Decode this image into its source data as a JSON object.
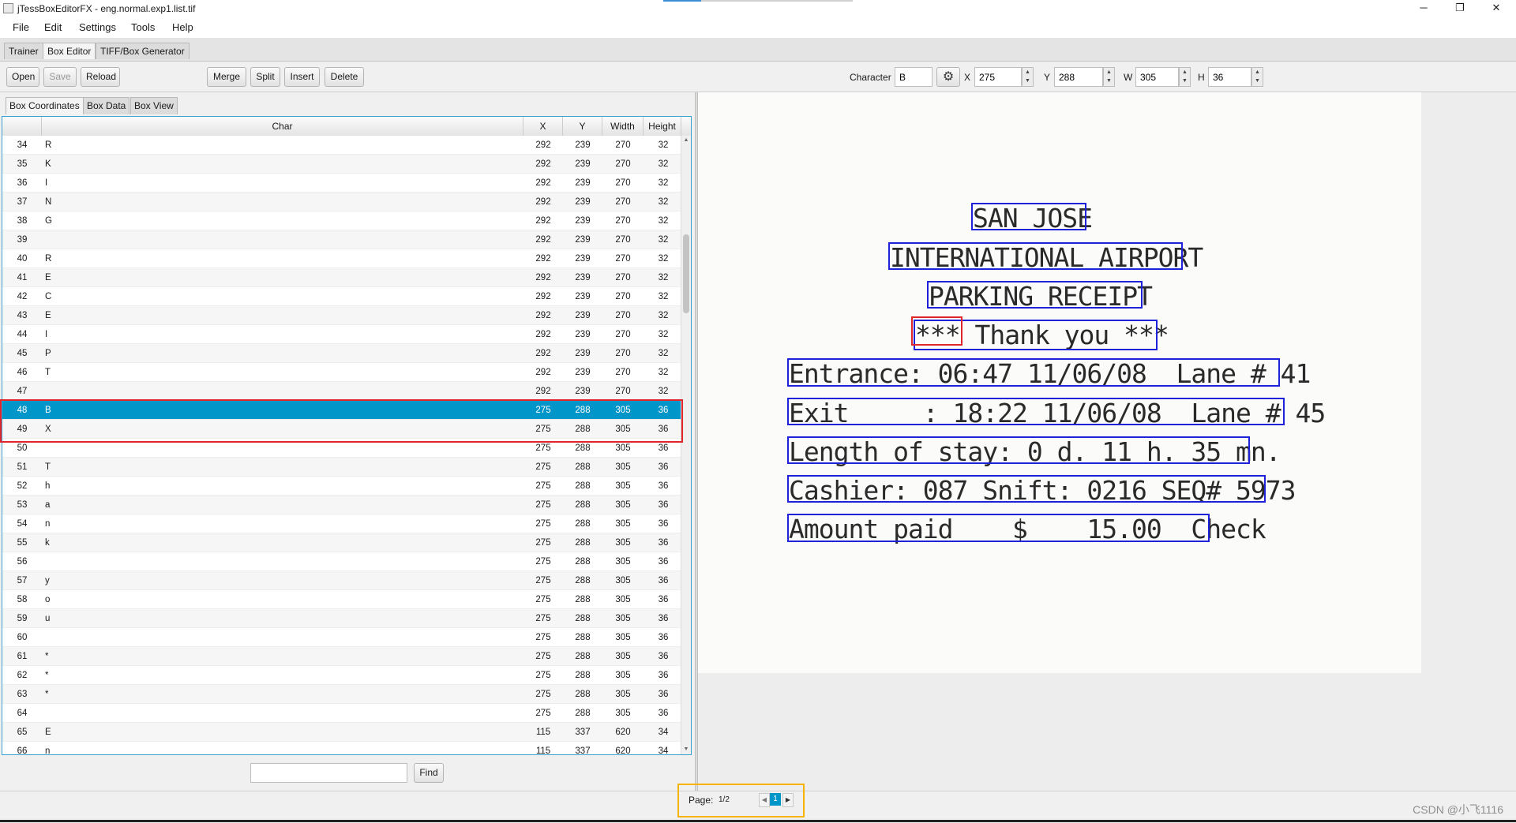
{
  "window": {
    "title": "jTessBoxEditorFX - eng.normal.exp1.list.tif",
    "controls": {
      "minimize": "─",
      "restore": "❐",
      "close": "✕"
    }
  },
  "menu": [
    "File",
    "Edit",
    "Settings",
    "Tools",
    "Help"
  ],
  "tabs": [
    "Trainer",
    "Box Editor",
    "TIFF/Box Generator"
  ],
  "toolbar": {
    "open": "Open",
    "save": "Save",
    "reload": "Reload",
    "merge": "Merge",
    "split": "Split",
    "insert": "Insert",
    "delete": "Delete",
    "character_label": "Character",
    "character_value": "B",
    "x_label": "X",
    "x_value": "275",
    "y_label": "Y",
    "y_value": "288",
    "w_label": "W",
    "w_value": "305",
    "h_label": "H",
    "h_value": "36"
  },
  "subtabs": [
    "Box Coordinates",
    "Box Data",
    "Box View"
  ],
  "table": {
    "columns": [
      "",
      "Char",
      "X",
      "Y",
      "Width",
      "Height"
    ],
    "rows": [
      {
        "idx": "34",
        "char": "R",
        "x": "292",
        "y": "239",
        "w": "270",
        "h": "32"
      },
      {
        "idx": "35",
        "char": "K",
        "x": "292",
        "y": "239",
        "w": "270",
        "h": "32"
      },
      {
        "idx": "36",
        "char": "I",
        "x": "292",
        "y": "239",
        "w": "270",
        "h": "32"
      },
      {
        "idx": "37",
        "char": "N",
        "x": "292",
        "y": "239",
        "w": "270",
        "h": "32"
      },
      {
        "idx": "38",
        "char": "G",
        "x": "292",
        "y": "239",
        "w": "270",
        "h": "32"
      },
      {
        "idx": "39",
        "char": "",
        "x": "292",
        "y": "239",
        "w": "270",
        "h": "32"
      },
      {
        "idx": "40",
        "char": "R",
        "x": "292",
        "y": "239",
        "w": "270",
        "h": "32"
      },
      {
        "idx": "41",
        "char": "E",
        "x": "292",
        "y": "239",
        "w": "270",
        "h": "32"
      },
      {
        "idx": "42",
        "char": "C",
        "x": "292",
        "y": "239",
        "w": "270",
        "h": "32"
      },
      {
        "idx": "43",
        "char": "E",
        "x": "292",
        "y": "239",
        "w": "270",
        "h": "32"
      },
      {
        "idx": "44",
        "char": "I",
        "x": "292",
        "y": "239",
        "w": "270",
        "h": "32"
      },
      {
        "idx": "45",
        "char": "P",
        "x": "292",
        "y": "239",
        "w": "270",
        "h": "32"
      },
      {
        "idx": "46",
        "char": "T",
        "x": "292",
        "y": "239",
        "w": "270",
        "h": "32"
      },
      {
        "idx": "47",
        "char": "",
        "x": "292",
        "y": "239",
        "w": "270",
        "h": "32"
      },
      {
        "idx": "48",
        "char": "B",
        "x": "275",
        "y": "288",
        "w": "305",
        "h": "36"
      },
      {
        "idx": "49",
        "char": "X",
        "x": "275",
        "y": "288",
        "w": "305",
        "h": "36"
      },
      {
        "idx": "50",
        "char": "",
        "x": "275",
        "y": "288",
        "w": "305",
        "h": "36"
      },
      {
        "idx": "51",
        "char": "T",
        "x": "275",
        "y": "288",
        "w": "305",
        "h": "36"
      },
      {
        "idx": "52",
        "char": "h",
        "x": "275",
        "y": "288",
        "w": "305",
        "h": "36"
      },
      {
        "idx": "53",
        "char": "a",
        "x": "275",
        "y": "288",
        "w": "305",
        "h": "36"
      },
      {
        "idx": "54",
        "char": "n",
        "x": "275",
        "y": "288",
        "w": "305",
        "h": "36"
      },
      {
        "idx": "55",
        "char": "k",
        "x": "275",
        "y": "288",
        "w": "305",
        "h": "36"
      },
      {
        "idx": "56",
        "char": "",
        "x": "275",
        "y": "288",
        "w": "305",
        "h": "36"
      },
      {
        "idx": "57",
        "char": "y",
        "x": "275",
        "y": "288",
        "w": "305",
        "h": "36"
      },
      {
        "idx": "58",
        "char": "o",
        "x": "275",
        "y": "288",
        "w": "305",
        "h": "36"
      },
      {
        "idx": "59",
        "char": "u",
        "x": "275",
        "y": "288",
        "w": "305",
        "h": "36"
      },
      {
        "idx": "60",
        "char": "",
        "x": "275",
        "y": "288",
        "w": "305",
        "h": "36"
      },
      {
        "idx": "61",
        "char": "*",
        "x": "275",
        "y": "288",
        "w": "305",
        "h": "36"
      },
      {
        "idx": "62",
        "char": "*",
        "x": "275",
        "y": "288",
        "w": "305",
        "h": "36"
      },
      {
        "idx": "63",
        "char": "*",
        "x": "275",
        "y": "288",
        "w": "305",
        "h": "36"
      },
      {
        "idx": "64",
        "char": "",
        "x": "275",
        "y": "288",
        "w": "305",
        "h": "36"
      },
      {
        "idx": "65",
        "char": "E",
        "x": "115",
        "y": "337",
        "w": "620",
        "h": "34"
      },
      {
        "idx": "66",
        "char": "n",
        "x": "115",
        "y": "337",
        "w": "620",
        "h": "34"
      }
    ],
    "selected_index": "48"
  },
  "find": {
    "value": "",
    "button": "Find"
  },
  "receipt": {
    "lines": [
      "SAN JOSE",
      "INTERNATIONAL AIRPORT",
      "PARKING RECEIPT",
      "*** Thank you ***",
      "Entrance: 06:47 11/06/08  Lane # 41",
      "Exit     : 18:22 11/06/08  Lane # 45",
      "Length of stay: 0 d. 11 h. 35 mn.",
      "Cashier: 087 Snift: 0216 SEQ# 5973",
      "Amount paid    $    15.00  Check"
    ]
  },
  "pager": {
    "label": "Page:",
    "value": "1/2",
    "current": "1",
    "prev": "◀",
    "next": "▶"
  },
  "watermark": "CSDN @小飞1116",
  "colors": {
    "accent": "#0096c9",
    "box": "#1f22d8",
    "highlight": "#e0262b",
    "callout": "#f4b400"
  },
  "icons": {
    "settings": "gear-icon"
  }
}
